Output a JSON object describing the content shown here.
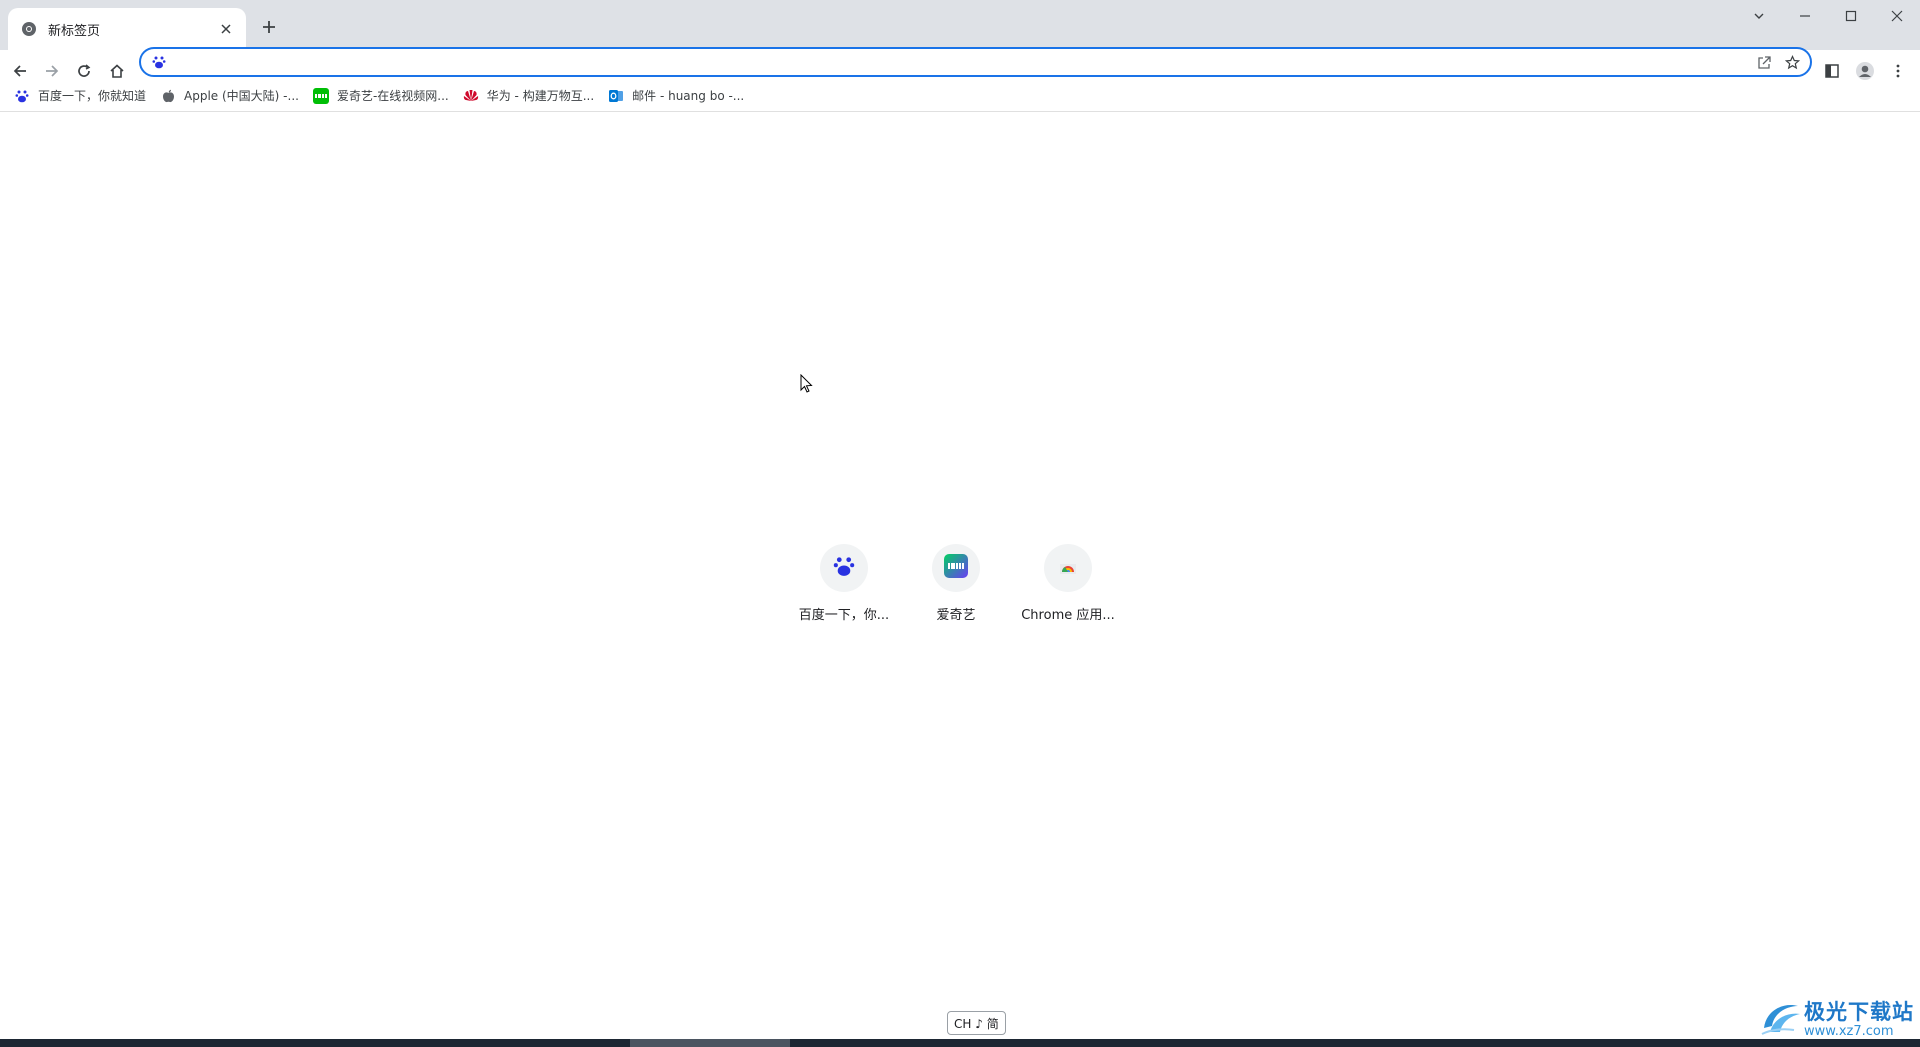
{
  "tab": {
    "title": "新标签页",
    "close": "×"
  },
  "omnibox": {
    "value": "",
    "placeholder": ""
  },
  "bookmarks": [
    {
      "label": "百度一下，你就知道",
      "icon": "baidu-icon"
    },
    {
      "label": "Apple (中国大陆) -...",
      "icon": "apple-icon"
    },
    {
      "label": "爱奇艺-在线视频网...",
      "icon": "iqiyi-icon"
    },
    {
      "label": "华为 - 构建万物互...",
      "icon": "huawei-icon"
    },
    {
      "label": "邮件 - huang bo -...",
      "icon": "outlook-icon"
    }
  ],
  "shortcuts": [
    {
      "label": "百度一下，你...",
      "icon": "baidu-icon"
    },
    {
      "label": "爱奇艺",
      "icon": "iqiyi-icon"
    },
    {
      "label": "Chrome 应用...",
      "icon": "chrome-webstore-icon"
    }
  ],
  "ime": {
    "label": "CH ♪ 简"
  },
  "watermark": {
    "name": "极光下载站",
    "url": "www.xz7.com"
  },
  "colors": {
    "accent": "#1a73e8",
    "tabstrip": "#dee1e6",
    "baidu": "#2932e1",
    "iqiyi": "#00be06",
    "huawei": "#cf0a2c",
    "outlook": "#0078d4"
  }
}
